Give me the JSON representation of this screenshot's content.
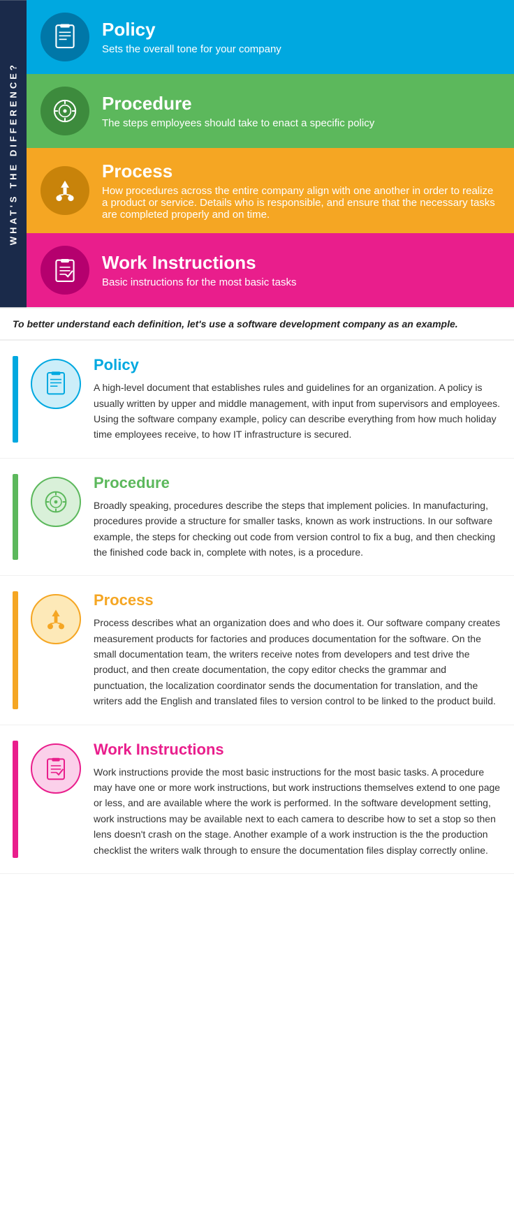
{
  "vertical_label": "WHAT'S THE DIFFERENCE?",
  "cards": [
    {
      "id": "policy",
      "title": "Policy",
      "subtitle": "Sets the overall tone for your company",
      "bg_class": "card-blue",
      "icon_bg_class": "icon-bg-blue",
      "bar_class": "bar-blue",
      "title_class": "title-blue",
      "icon_detail_bg": "detail-icon-bg-blue"
    },
    {
      "id": "procedure",
      "title": "Procedure",
      "subtitle": "The steps employees should take to enact a specific policy",
      "bg_class": "card-green",
      "icon_bg_class": "icon-bg-green",
      "bar_class": "bar-green",
      "title_class": "title-green",
      "icon_detail_bg": "detail-icon-bg-green"
    },
    {
      "id": "process",
      "title": "Process",
      "subtitle": "How procedures across the entire company align with one another in order to realize a product or service. Details who  is responsible, and ensure that the necessary tasks are completed properly and on time.",
      "bg_class": "card-orange",
      "icon_bg_class": "icon-bg-orange",
      "bar_class": "bar-orange",
      "title_class": "title-orange",
      "icon_detail_bg": "detail-icon-bg-orange"
    },
    {
      "id": "work-instructions",
      "title": "Work Instructions",
      "subtitle": "Basic instructions for the most basic tasks",
      "bg_class": "card-pink",
      "icon_bg_class": "icon-bg-pink",
      "bar_class": "bar-pink",
      "title_class": "title-pink",
      "icon_detail_bg": "detail-icon-bg-pink"
    }
  ],
  "middle_banner": "To better understand each definition, let's use a software development company as an example.",
  "details": [
    {
      "id": "policy-detail",
      "title": "Policy",
      "bar_class": "bar-blue",
      "title_class": "title-blue",
      "icon_detail_bg": "detail-icon-bg-blue",
      "text": "A high-level document that establishes rules and guidelines for an organization. A policy is usually written by upper and middle management, with input from supervisors and employees. Using the software company example, policy can describe everything from how much holiday time employees receive, to how IT infrastructure is secured."
    },
    {
      "id": "procedure-detail",
      "title": "Procedure",
      "bar_class": "bar-green",
      "title_class": "title-green",
      "icon_detail_bg": "detail-icon-bg-green",
      "text": "Broadly speaking, procedures describe the steps that implement policies. In manufacturing, procedures provide a structure for smaller tasks, known as work instructions. In our software example, the steps for checking out code from version control to fix a bug, and then checking the finished code back in, complete with notes, is a procedure."
    },
    {
      "id": "process-detail",
      "title": "Process",
      "bar_class": "bar-orange",
      "title_class": "title-orange",
      "icon_detail_bg": "detail-icon-bg-orange",
      "text": "Process describes what an organization does and who does it. Our software company creates measurement products for factories and produces documentation for the software. On the small documentation team, the writers receive notes from developers and test drive the product, and then create documentation, the copy editor checks the grammar and punctuation, the localization coordinator sends the documentation for translation, and the writers add the English and translated files to version control to be linked to the product build."
    },
    {
      "id": "work-instructions-detail",
      "title": "Work Instructions",
      "bar_class": "bar-pink",
      "title_class": "title-pink",
      "icon_detail_bg": "detail-icon-bg-pink",
      "text": "Work instructions provide the most basic instructions for the most basic tasks. A procedure may have one or more work instructions, but work instructions themselves extend to one page or less, and are available where the work is performed. In the software development setting, work instructions may be available next to each camera to describe how to set a stop so then lens doesn't crash on the stage. Another example of a work instruction is the the production checklist the writers walk through to ensure the documentation files display correctly online."
    }
  ]
}
